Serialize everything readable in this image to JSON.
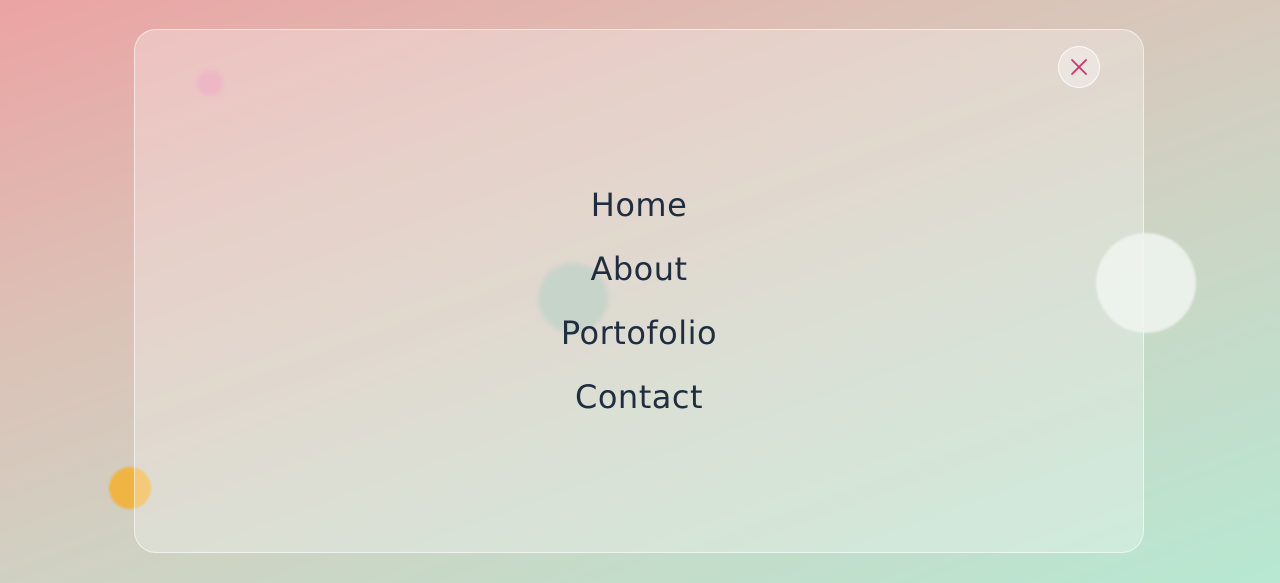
{
  "nav": {
    "items": [
      {
        "label": "Home"
      },
      {
        "label": "About"
      },
      {
        "label": "Portofolio"
      },
      {
        "label": "Contact"
      }
    ]
  },
  "close_button": {
    "icon": "close-icon",
    "color": "#d6336c"
  },
  "colors": {
    "text": "#1f2d3f",
    "accent": "#d6336c"
  }
}
